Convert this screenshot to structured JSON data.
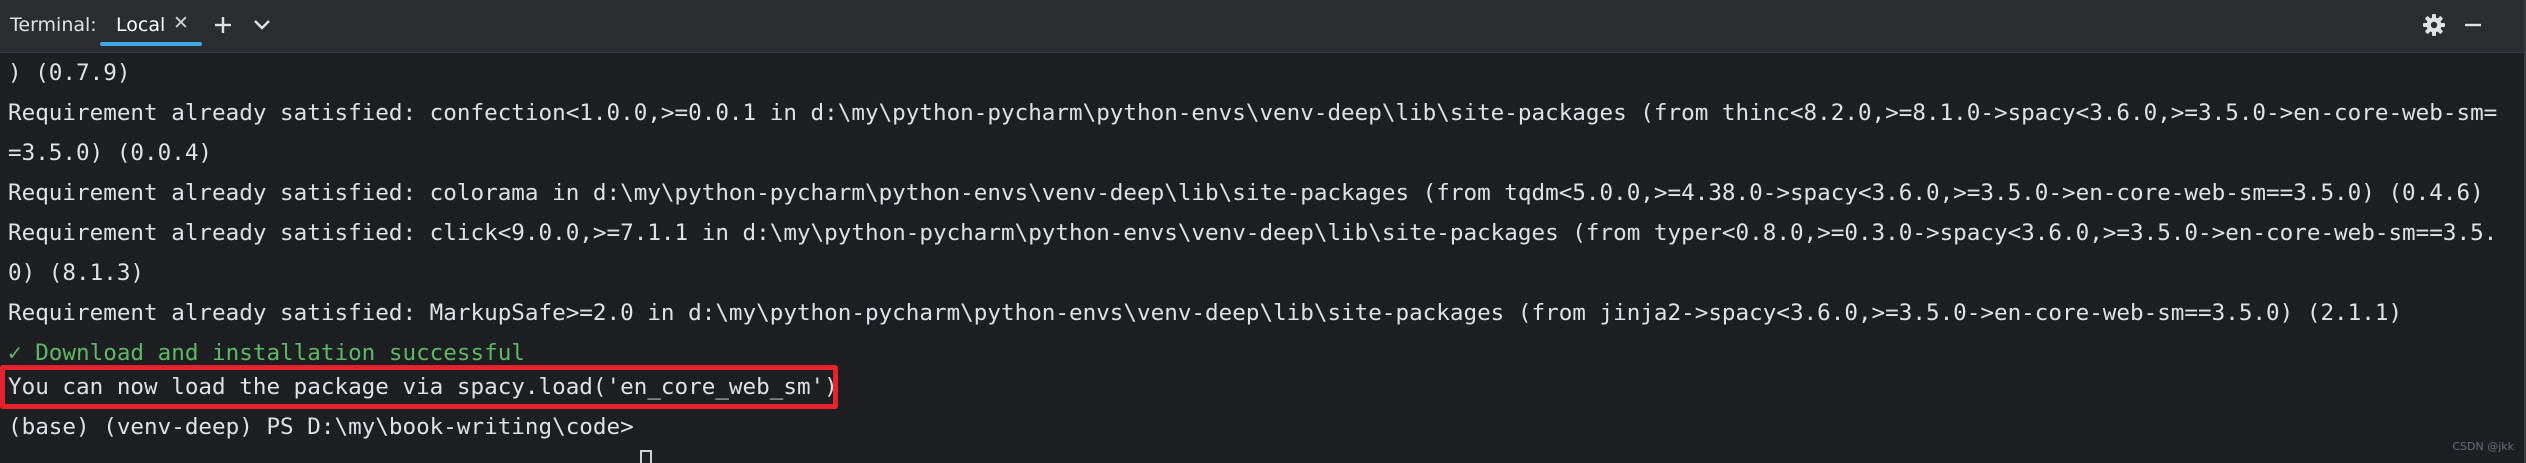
{
  "toolwindow": {
    "title": "Terminal:",
    "tabs": [
      {
        "label": "Local",
        "active": true
      }
    ],
    "icons": {
      "close_tab": "close-icon",
      "new_tab": "plus-icon",
      "tab_menu": "chevron-down-icon",
      "settings": "gear-icon",
      "hide": "minimize-icon"
    }
  },
  "terminal": {
    "lines": [
      ") (0.7.9)",
      "Requirement already satisfied: confection<1.0.0,>=0.0.1 in d:\\my\\python-pycharm\\python-envs\\venv-deep\\lib\\site-packages (from thinc<8.2.0,>=8.1.0->spacy<3.6.0,>=3.5.0->en-core-web-sm=",
      "=3.5.0) (0.0.4)",
      "Requirement already satisfied: colorama in d:\\my\\python-pycharm\\python-envs\\venv-deep\\lib\\site-packages (from tqdm<5.0.0,>=4.38.0->spacy<3.6.0,>=3.5.0->en-core-web-sm==3.5.0) (0.4.6)",
      "Requirement already satisfied: click<9.0.0,>=7.1.1 in d:\\my\\python-pycharm\\python-envs\\venv-deep\\lib\\site-packages (from typer<0.8.0,>=0.3.0->spacy<3.6.0,>=3.5.0->en-core-web-sm==3.5.",
      "0) (8.1.3)",
      "Requirement already satisfied: MarkupSafe>=2.0 in d:\\my\\python-pycharm\\python-envs\\venv-deep\\lib\\site-packages (from jinja2->spacy<3.6.0,>=3.5.0->en-core-web-sm==3.5.0) (2.1.1)",
      "✓ Download and installation successful",
      "You can now load the package via spacy.load('en_core_web_sm')",
      "(base) (venv-deep) PS D:\\my\\book-writing\\code>"
    ],
    "success_color": "#5fb865",
    "highlight_color": "#e8232d",
    "tab_accent_color": "#3daae0"
  },
  "watermark": "CSDN @jkk"
}
